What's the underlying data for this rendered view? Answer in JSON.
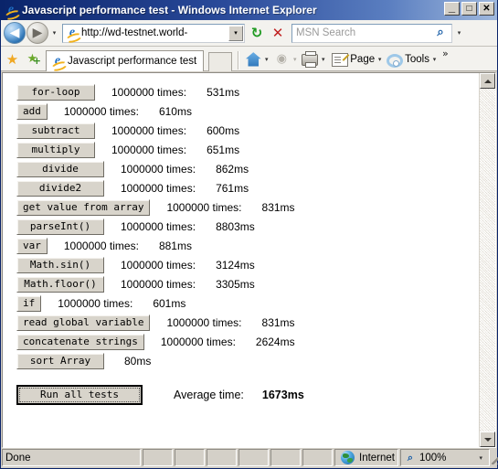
{
  "window": {
    "title": "Javascript performance test - Windows Internet Explorer",
    "minimize_label": "_",
    "maximize_label": "□",
    "close_label": "✕"
  },
  "navbar": {
    "back_label": "◀",
    "forward_label": "▶",
    "history_caret": "▾",
    "address_value": "http://wd-testnet.world-",
    "address_dropdown_caret": "▾",
    "refresh_label": "↻",
    "stop_label": "✕",
    "search_placeholder": "MSN Search",
    "search_go_label": "⌕",
    "search_dropdown_caret": "▾"
  },
  "tabbar": {
    "favorites_label": "★",
    "add_favorites_label": "★",
    "add_favorites_badge": "+",
    "tab_label": "Javascript performance test",
    "new_tab_label": "",
    "home_label": "",
    "home_caret": "▾",
    "feeds_label": "◉",
    "feeds_caret": "▾",
    "print_label": "",
    "print_caret": "▾",
    "page_label": "Page",
    "page_caret": "▾",
    "tools_label": "Tools",
    "tools_caret": "▾",
    "overflow_label": "»"
  },
  "page": {
    "times_label": "1000000 times:",
    "rows": [
      {
        "button": "for-loop",
        "times": "1000000 times:",
        "ms": "531ms",
        "size": "wide-sm"
      },
      {
        "button": "add",
        "times": "1000000 times:",
        "ms": "610ms",
        "size": "auto"
      },
      {
        "button": "subtract",
        "times": "1000000 times:",
        "ms": "600ms",
        "size": "wide-sm"
      },
      {
        "button": "multiply",
        "times": "1000000 times:",
        "ms": "651ms",
        "size": "wide-sm"
      },
      {
        "button": "divide",
        "times": "1000000 times:",
        "ms": "862ms",
        "size": "wide-md"
      },
      {
        "button": "divide2",
        "times": "1000000 times:",
        "ms": "761ms",
        "size": "wide-md"
      },
      {
        "button": "get value from array",
        "times": "1000000 times:",
        "ms": "831ms",
        "size": "wide-lg"
      },
      {
        "button": "parseInt()",
        "times": "1000000 times:",
        "ms": "8803ms",
        "size": "wide-md"
      },
      {
        "button": "var",
        "times": "1000000 times:",
        "ms": "881ms",
        "size": "auto"
      },
      {
        "button": "Math.sin()",
        "times": "1000000 times:",
        "ms": "3124ms",
        "size": "wide-md"
      },
      {
        "button": "Math.floor()",
        "times": "1000000 times:",
        "ms": "3305ms",
        "size": "wide-md"
      },
      {
        "button": "if",
        "times": "1000000 times:",
        "ms": "601ms",
        "size": "auto"
      },
      {
        "button": "read global variable",
        "times": "1000000 times:",
        "ms": "831ms",
        "size": "wide-lg"
      },
      {
        "button": "concatenate strings",
        "times": "1000000 times:",
        "ms": "2624ms",
        "size": "wide-lg"
      },
      {
        "button": "sort Array",
        "times": "",
        "ms": "80ms",
        "size": "wide-md"
      }
    ],
    "run_all_label": "Run all tests",
    "average_label": "Average time:",
    "average_value": "1673ms"
  },
  "scrollbar": {
    "up_label": "▲",
    "down_label": "▼"
  },
  "statusbar": {
    "status": "Done",
    "zone": "Internet",
    "zoom": "100%",
    "zoom_caret": "▾"
  }
}
